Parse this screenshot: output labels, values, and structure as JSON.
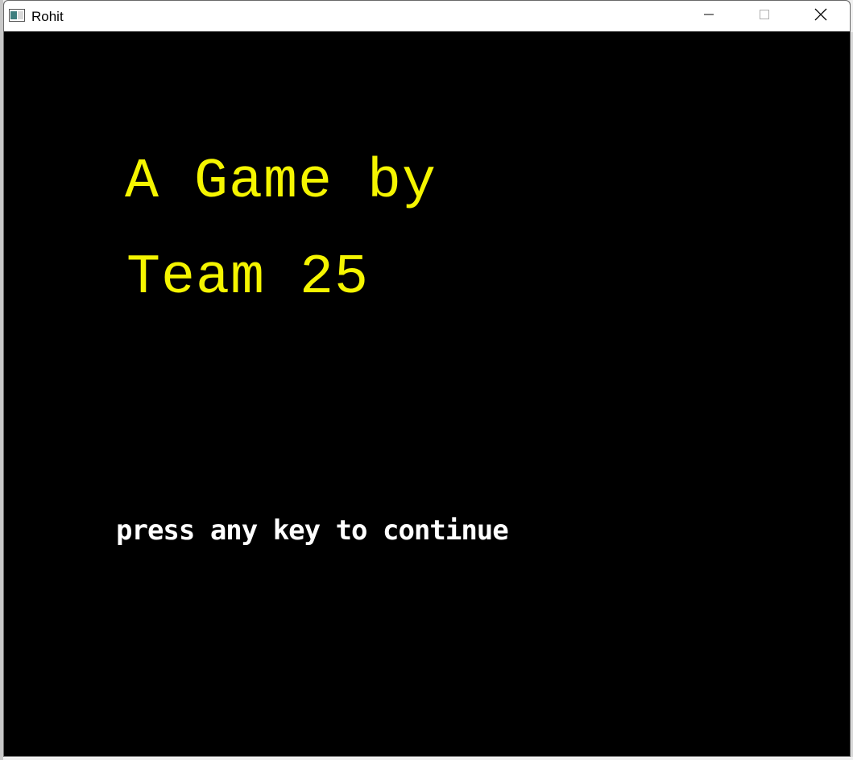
{
  "window": {
    "title": "Rohit",
    "icons": {
      "app": "app-window-icon",
      "minimize": "minimize-icon",
      "maximize": "maximize-icon",
      "close": "close-icon"
    }
  },
  "game": {
    "title_line_1": "A Game by",
    "title_line_2": "Team 25",
    "prompt": "press any key to continue",
    "colors": {
      "background": "#000000",
      "title": "#f5f500",
      "prompt": "#ffffff"
    }
  }
}
